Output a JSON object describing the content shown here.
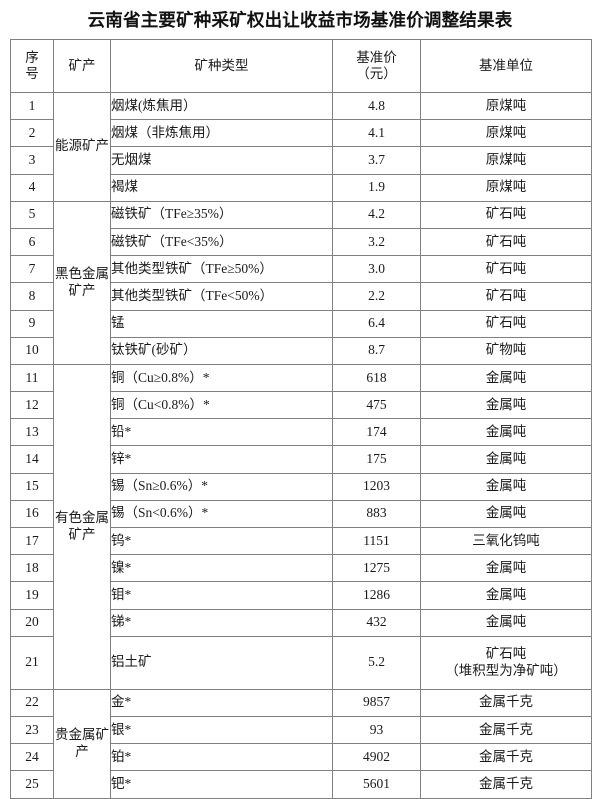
{
  "document": {
    "title": "云南省主要矿种采矿权出让收益市场基准价调整结果表"
  },
  "table": {
    "columns": [
      {
        "key": "no",
        "label": "序号",
        "label_lines": [
          "序",
          "号"
        ]
      },
      {
        "key": "cat",
        "label": "矿产",
        "label_lines": [
          "矿产"
        ]
      },
      {
        "key": "type",
        "label": "矿种类型",
        "label_lines": [
          "矿种类型"
        ]
      },
      {
        "key": "price",
        "label": "基准价（元）",
        "label_lines": [
          "基准价",
          "（元）"
        ]
      },
      {
        "key": "unit",
        "label": "基准单位",
        "label_lines": [
          "基准单位"
        ]
      }
    ],
    "categories": [
      {
        "name": "能源矿产",
        "rowspan": 4
      },
      {
        "name": "黑色金属矿产",
        "rowspan": 6
      },
      {
        "name": "有色金属矿产",
        "rowspan": 11
      },
      {
        "name": "贵金属矿产",
        "rowspan": 4
      }
    ],
    "rows": [
      {
        "no": "1",
        "category": "能源矿产",
        "type": "烟煤(炼焦用）",
        "price": "4.8",
        "unit": "原煤吨"
      },
      {
        "no": "2",
        "category": "能源矿产",
        "type": "烟煤（非炼焦用）",
        "price": "4.1",
        "unit": "原煤吨"
      },
      {
        "no": "3",
        "category": "能源矿产",
        "type": "无烟煤",
        "price": "3.7",
        "unit": "原煤吨"
      },
      {
        "no": "4",
        "category": "能源矿产",
        "type": "褐煤",
        "price": "1.9",
        "unit": "原煤吨"
      },
      {
        "no": "5",
        "category": "黑色金属矿产",
        "type": "磁铁矿（TFe≥35%）",
        "price": "4.2",
        "unit": "矿石吨"
      },
      {
        "no": "6",
        "category": "黑色金属矿产",
        "type": "磁铁矿（TFe<35%）",
        "price": "3.2",
        "unit": "矿石吨"
      },
      {
        "no": "7",
        "category": "黑色金属矿产",
        "type": "其他类型铁矿（TFe≥50%）",
        "price": "3.0",
        "unit": "矿石吨"
      },
      {
        "no": "8",
        "category": "黑色金属矿产",
        "type": "其他类型铁矿（TFe<50%）",
        "price": "2.2",
        "unit": "矿石吨"
      },
      {
        "no": "9",
        "category": "黑色金属矿产",
        "type": "锰",
        "price": "6.4",
        "unit": "矿石吨"
      },
      {
        "no": "10",
        "category": "黑色金属矿产",
        "type": "钛铁矿(砂矿）",
        "price": "8.7",
        "unit": "矿物吨"
      },
      {
        "no": "11",
        "category": "有色金属矿产",
        "type": "铜（Cu≥0.8%）*",
        "price": "618",
        "unit": "金属吨"
      },
      {
        "no": "12",
        "category": "有色金属矿产",
        "type": "铜（Cu<0.8%）*",
        "price": "475",
        "unit": "金属吨"
      },
      {
        "no": "13",
        "category": "有色金属矿产",
        "type": "铅*",
        "price": "174",
        "unit": "金属吨"
      },
      {
        "no": "14",
        "category": "有色金属矿产",
        "type": "锌*",
        "price": "175",
        "unit": "金属吨"
      },
      {
        "no": "15",
        "category": "有色金属矿产",
        "type": "锡（Sn≥0.6%）*",
        "price": "1203",
        "unit": "金属吨"
      },
      {
        "no": "16",
        "category": "有色金属矿产",
        "type": "锡（Sn<0.6%）*",
        "price": "883",
        "unit": "金属吨"
      },
      {
        "no": "17",
        "category": "有色金属矿产",
        "type": "钨*",
        "price": "1151",
        "unit": "三氧化钨吨"
      },
      {
        "no": "18",
        "category": "有色金属矿产",
        "type": "镍*",
        "price": "1275",
        "unit": "金属吨"
      },
      {
        "no": "19",
        "category": "有色金属矿产",
        "type": "钼*",
        "price": "1286",
        "unit": "金属吨"
      },
      {
        "no": "20",
        "category": "有色金属矿产",
        "type": "锑*",
        "price": "432",
        "unit": "金属吨"
      },
      {
        "no": "21",
        "category": "有色金属矿产",
        "type": "铝土矿",
        "price": "5.2",
        "unit": "矿石吨",
        "unit_line2": "（堆积型为净矿吨）",
        "tall": true
      },
      {
        "no": "22",
        "category": "贵金属矿产",
        "type": "金*",
        "price": "9857",
        "unit": "金属千克"
      },
      {
        "no": "23",
        "category": "贵金属矿产",
        "type": "银*",
        "price": "93",
        "unit": "金属千克"
      },
      {
        "no": "24",
        "category": "贵金属矿产",
        "type": "铂*",
        "price": "4902",
        "unit": "金属千克"
      },
      {
        "no": "25",
        "category": "贵金属矿产",
        "type": "钯*",
        "price": "5601",
        "unit": "金属千克"
      }
    ]
  },
  "style": {
    "border_color": "#808080",
    "text_color": "#1a1a1a",
    "background": "#ffffff"
  }
}
